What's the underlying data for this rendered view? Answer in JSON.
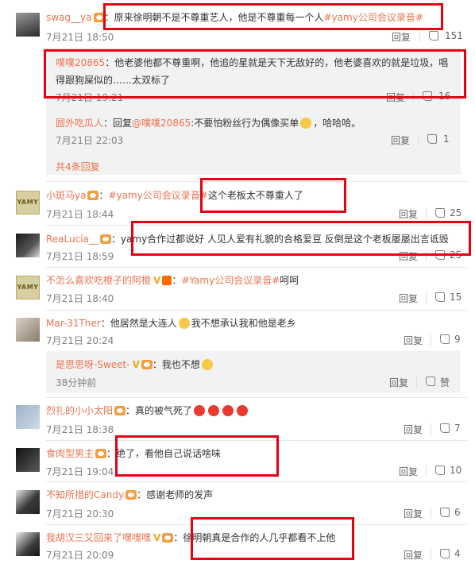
{
  "comments": [
    {
      "user": "swag__ya",
      "text": "原来徐明朝不是不尊重艺人，他是不尊重每一个人",
      "tag": "#yamy公司会议录音#",
      "time": "7月21日 18:50",
      "reply": "回复",
      "likes": "151",
      "replies": [
        {
          "user": "噗噗20865",
          "text": "他老婆他都不尊重啊，他追的星就是天下无敌好的，他老婆喜欢的就是垃圾，唱得跟狗屎似的……太双标了",
          "time": "7月21日 19:21",
          "reply": "回复",
          "likes": "16"
        },
        {
          "user": "圆外吃瓜人",
          "text_prefix": "回复",
          "mention": "@噗噗20865",
          "text": ":不要怕粉丝行为偶像买单",
          "text_suffix": "，哈哈哈。",
          "time": "7月21日 22:03",
          "reply": "回复",
          "likes": "1"
        }
      ],
      "more": "共4条回复"
    },
    {
      "user": "小斑马ya",
      "tag": "#yamy公司会议录音#",
      "text": "这个老板太不尊重人了",
      "time": "7月21日 18:44",
      "reply": "回复",
      "likes": "25"
    },
    {
      "user": "ReaLucia__",
      "text": "yamy合作过都说好 人见人爱有礼貌的合格爱豆 反倒是这个老板屡屡出言诋毁",
      "time": "7月21日 18:59",
      "reply": "回复",
      "likes": "25"
    },
    {
      "user": "不怎么喜欢吃橙子的阿橙",
      "tag": "#Yamy公司会议录音#",
      "text": "呵呵",
      "time": "7月21日 18:40",
      "reply": "回复",
      "likes": "15"
    },
    {
      "user": "Mar-31Ther",
      "text": "他居然是大连人",
      "text2": "我不想承认我和他是老乡",
      "time": "7月21日 20:24",
      "reply": "回复",
      "likes": "9",
      "replies": [
        {
          "user": "是思思呀-Sweet-",
          "text": "我也不想",
          "time": "38分钟前",
          "reply": "回复",
          "likes": "赞"
        }
      ]
    },
    {
      "user": "烈扎的小小太阳",
      "text": "真的被气死了",
      "time": "7月21日 18:38",
      "reply": "回复",
      "likes": "7"
    },
    {
      "user": "食肉型男主",
      "text": "绝了，看他自己说话啥味",
      "time": "7月21日 19:04",
      "reply": "回复",
      "likes": "10"
    },
    {
      "user": "不知所措的Candy",
      "text": "感谢老师的发声",
      "time": "7月21日 20:30",
      "reply": "回复",
      "likes": "6"
    },
    {
      "user": "我胡汉三又回来了嘿嘿嘿",
      "text": "徐明朝真是合作的人几乎都看不上他",
      "time": "7月21日 20:09",
      "reply": "回复",
      "likes": "4"
    }
  ],
  "avatar_logo": "YAMY",
  "vip_mark": "V",
  "colors": {
    "username": "#eb7350",
    "highlight": "#e60012",
    "subbox": "#f2f2f2"
  }
}
